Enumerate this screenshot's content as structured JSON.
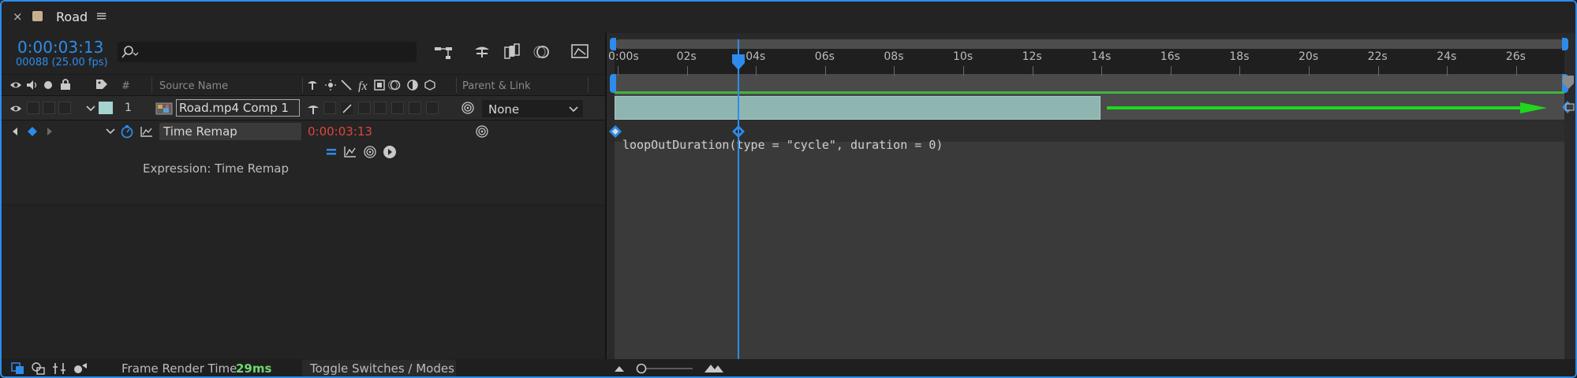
{
  "tab": {
    "title": "Road",
    "close_glyph": "×",
    "menu_glyph": "≡",
    "swatch_color": "#c7b090"
  },
  "time": {
    "timecode": "0:00:03:13",
    "frames": "00088 (25.00 fps)"
  },
  "search": {
    "placeholder": ""
  },
  "columns": {
    "hash": "#",
    "source_name": "Source Name",
    "parent_link": "Parent & Link"
  },
  "layer": {
    "number": "1",
    "name": "Road.mp4 Comp 1",
    "parent": "None",
    "label_color": "#a7d3cf"
  },
  "property": {
    "name": "Time Remap",
    "value": "0:00:03:13"
  },
  "expression": {
    "label": "Expression: Time Remap",
    "code": "loopOutDuration(type = \"cycle\", duration = 0)"
  },
  "ruler": {
    "ticks": [
      "0:00s",
      "02s",
      "04s",
      "06s",
      "08s",
      "10s",
      "12s",
      "14s",
      "16s",
      "18s",
      "20s",
      "22s",
      "24s",
      "26s"
    ]
  },
  "bottom": {
    "frame_render_label": "Frame Render Time",
    "frame_render_value": "29ms",
    "toggle_label": "Toggle Switches / Modes"
  },
  "colors": {
    "accent": "#2d8ceb",
    "layer_bar": "#8fb5b1",
    "arrow": "#1ed81e",
    "value_red": "#e0453a",
    "render_green": "#6ed66e"
  }
}
